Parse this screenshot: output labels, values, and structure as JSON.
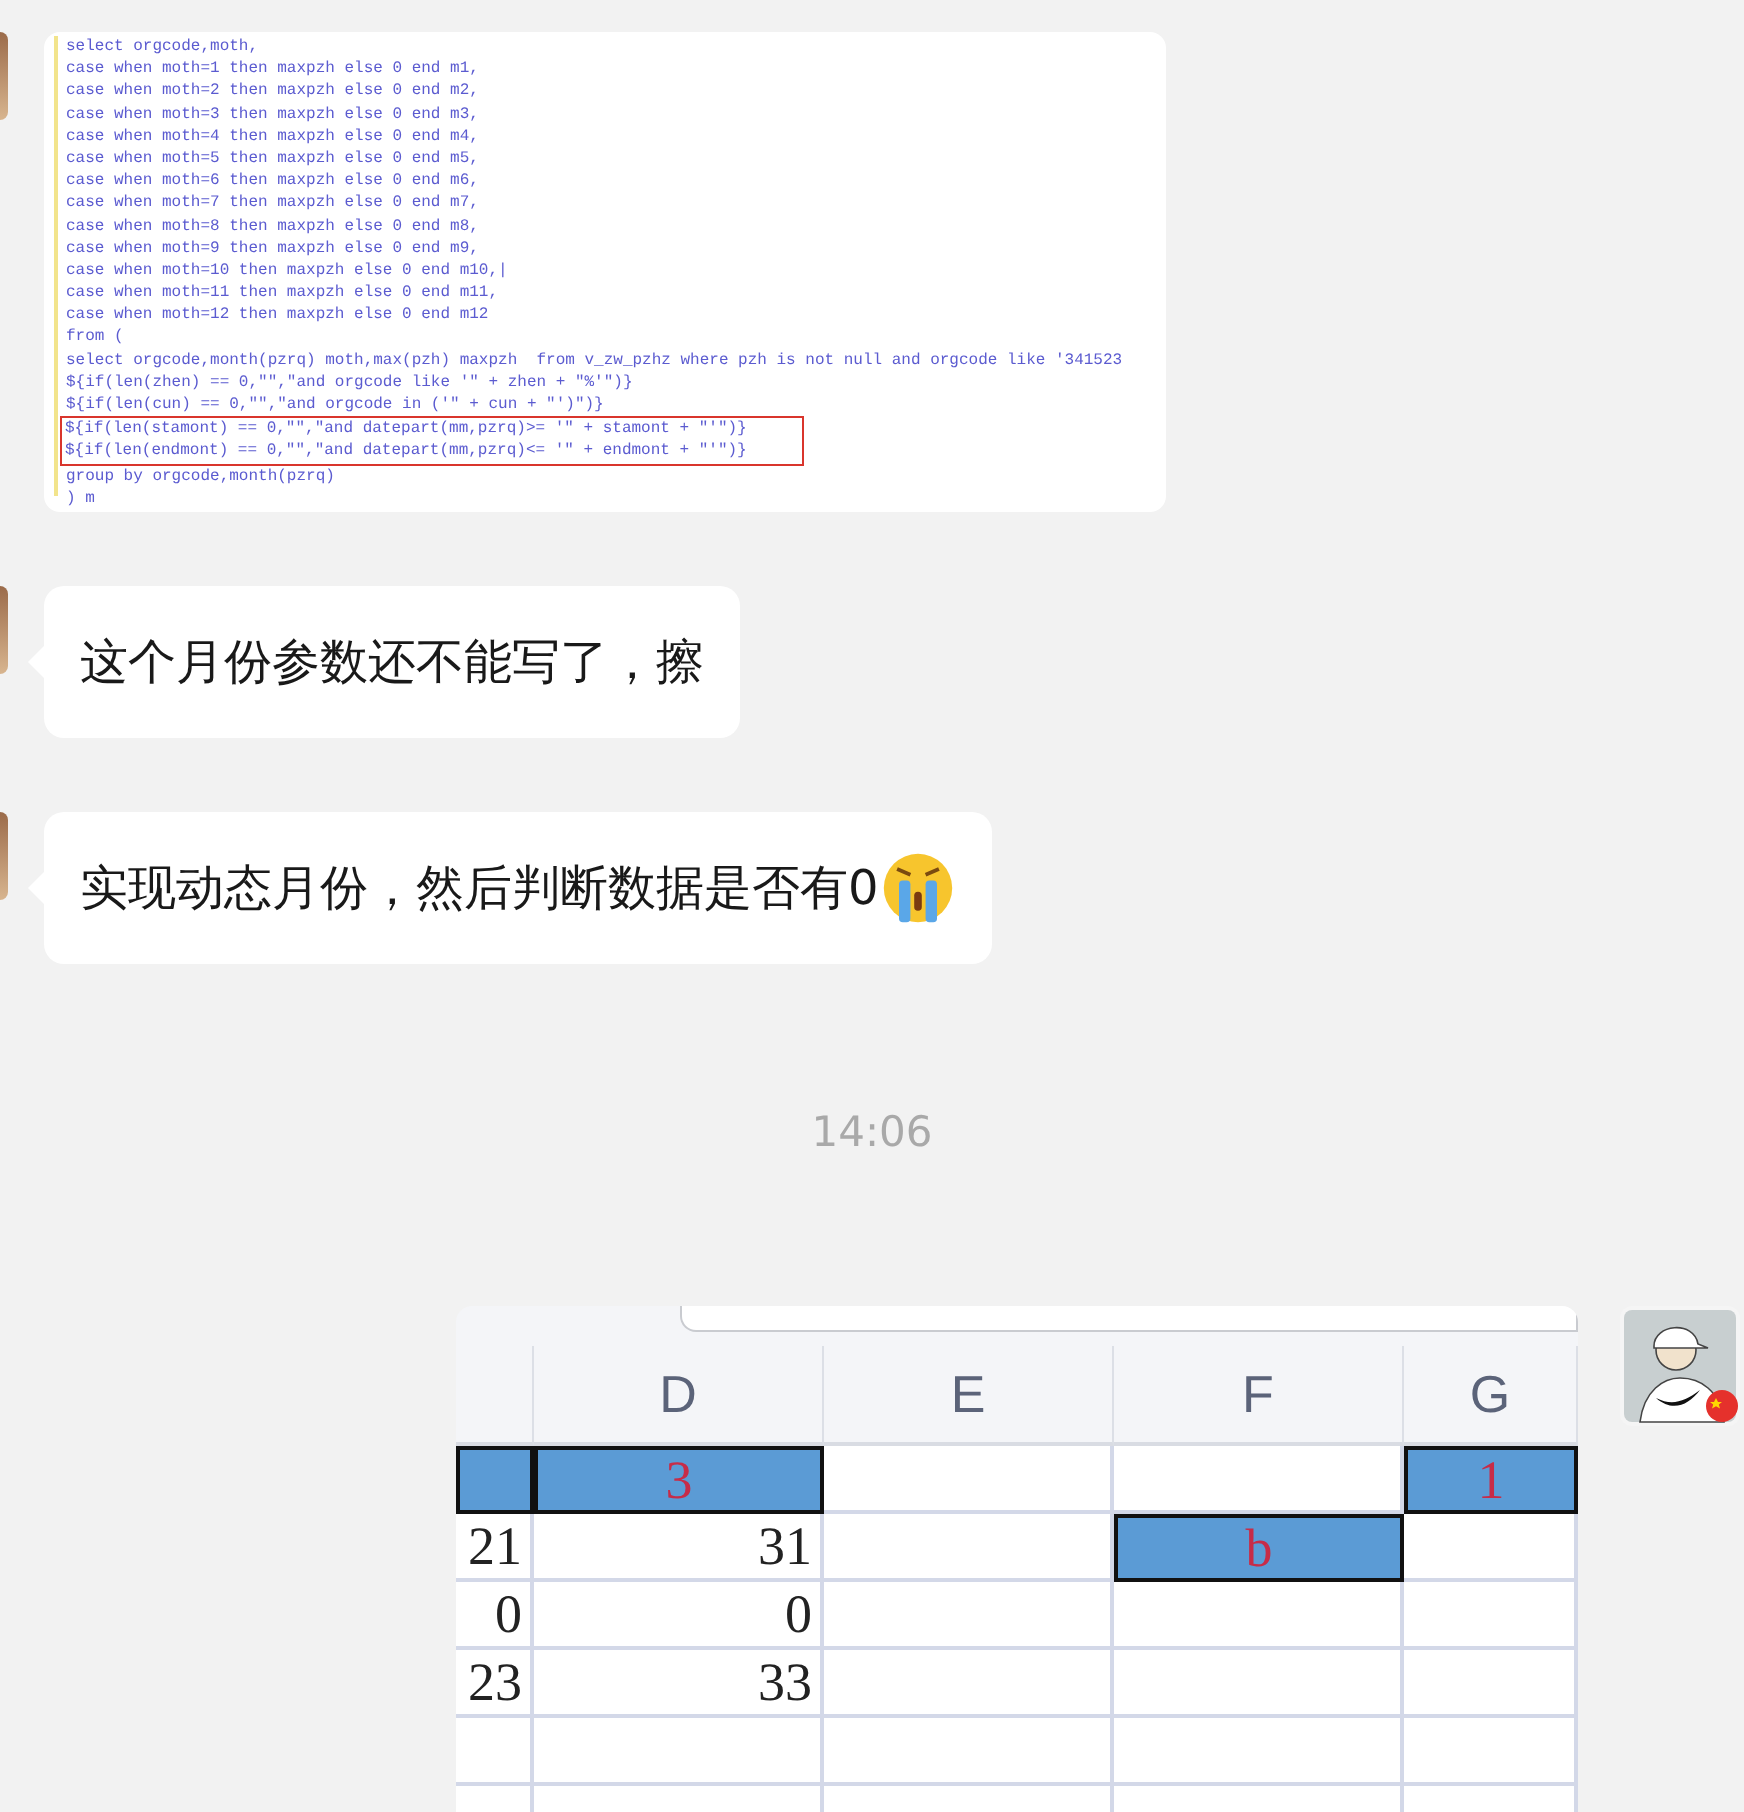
{
  "messages": [
    {
      "kind": "code_image",
      "lines": [
        {
          "text": "select orgcode,moth,",
          "highlighted": false
        },
        {
          "text": "case when moth=1 then maxpzh else 0 end m1,",
          "highlighted": false
        },
        {
          "text": "case when moth=2 then maxpzh else 0 end m2,",
          "highlighted": false
        },
        {
          "text": "case when moth=3 then maxpzh else 0 end m3,",
          "highlighted": false
        },
        {
          "text": "case when moth=4 then maxpzh else 0 end m4,",
          "highlighted": false
        },
        {
          "text": "case when moth=5 then maxpzh else 0 end m5,",
          "highlighted": false
        },
        {
          "text": "case when moth=6 then maxpzh else 0 end m6,",
          "highlighted": false
        },
        {
          "text": "case when moth=7 then maxpzh else 0 end m7,",
          "highlighted": false
        },
        {
          "text": "case when moth=8 then maxpzh else 0 end m8,",
          "highlighted": false
        },
        {
          "text": "case when moth=9 then maxpzh else 0 end m9,",
          "highlighted": false
        },
        {
          "text": "case when moth=10 then maxpzh else 0 end m10,|",
          "highlighted": false
        },
        {
          "text": "case when moth=11 then maxpzh else 0 end m11,",
          "highlighted": false
        },
        {
          "text": "case when moth=12 then maxpzh else 0 end m12",
          "highlighted": false
        },
        {
          "text": "from (",
          "highlighted": false
        },
        {
          "text": "select orgcode,month(pzrq) moth,max(pzh) maxpzh  from v_zw_pzhz where pzh is not null and orgcode like '341523",
          "highlighted": false
        },
        {
          "text": "${if(len(zhen) == 0,\"\",\"and orgcode like '\" + zhen + \"%'\")}",
          "highlighted": false
        },
        {
          "text": "${if(len(cun) == 0,\"\",\"and orgcode in ('\" + cun + \"')\")}",
          "highlighted": false
        },
        {
          "text": "${if(len(stamont) == 0,\"\",\"and datepart(mm,pzrq)>= '\" + stamont + \"'\")}",
          "highlighted": true
        },
        {
          "text": "${if(len(endmont) == 0,\"\",\"and datepart(mm,pzrq)<= '\" + endmont + \"'\")}",
          "highlighted": true
        },
        {
          "text": "group by orgcode,month(pzrq)",
          "highlighted": false
        },
        {
          "text": ") m",
          "highlighted": false
        }
      ]
    },
    {
      "kind": "text",
      "text": "这个月份参数还不能写了，擦"
    },
    {
      "kind": "text",
      "text": "实现动态月份，然后判断数据是否有0",
      "emoji": true
    },
    {
      "kind": "time",
      "text": "14:06"
    },
    {
      "kind": "sheet_image",
      "columns": [
        "",
        "D",
        "E",
        "F",
        "G"
      ],
      "rows": [
        {
          "cells": [
            {
              "selected": true
            },
            {
              "text": "3",
              "selected": true
            },
            {
              "selected": false
            },
            {
              "selected": false
            },
            {
              "text": "1",
              "selected": true
            }
          ]
        },
        {
          "cells": [
            {
              "text": "21",
              "selected": false
            },
            {
              "text": "31",
              "selected": false
            },
            {
              "selected": false
            },
            {
              "text": "b",
              "selected": true
            },
            {
              "selected": false
            }
          ]
        },
        {
          "cells": [
            {
              "text": "0",
              "selected": false
            },
            {
              "text": "0",
              "selected": false
            },
            {
              "selected": false
            },
            {
              "selected": false
            },
            {
              "selected": false
            }
          ]
        },
        {
          "cells": [
            {
              "text": "23",
              "selected": false
            },
            {
              "text": "33",
              "selected": false
            },
            {
              "selected": false
            },
            {
              "selected": false
            },
            {
              "selected": false
            }
          ]
        },
        {
          "cells": [
            {
              "selected": false
            },
            {
              "selected": false
            },
            {
              "selected": false
            },
            {
              "selected": false
            },
            {
              "selected": false
            }
          ]
        },
        {
          "cells": [
            {
              "selected": false
            },
            {
              "selected": false
            },
            {
              "selected": false
            },
            {
              "selected": false
            },
            {
              "selected": false
            }
          ]
        }
      ]
    }
  ]
}
